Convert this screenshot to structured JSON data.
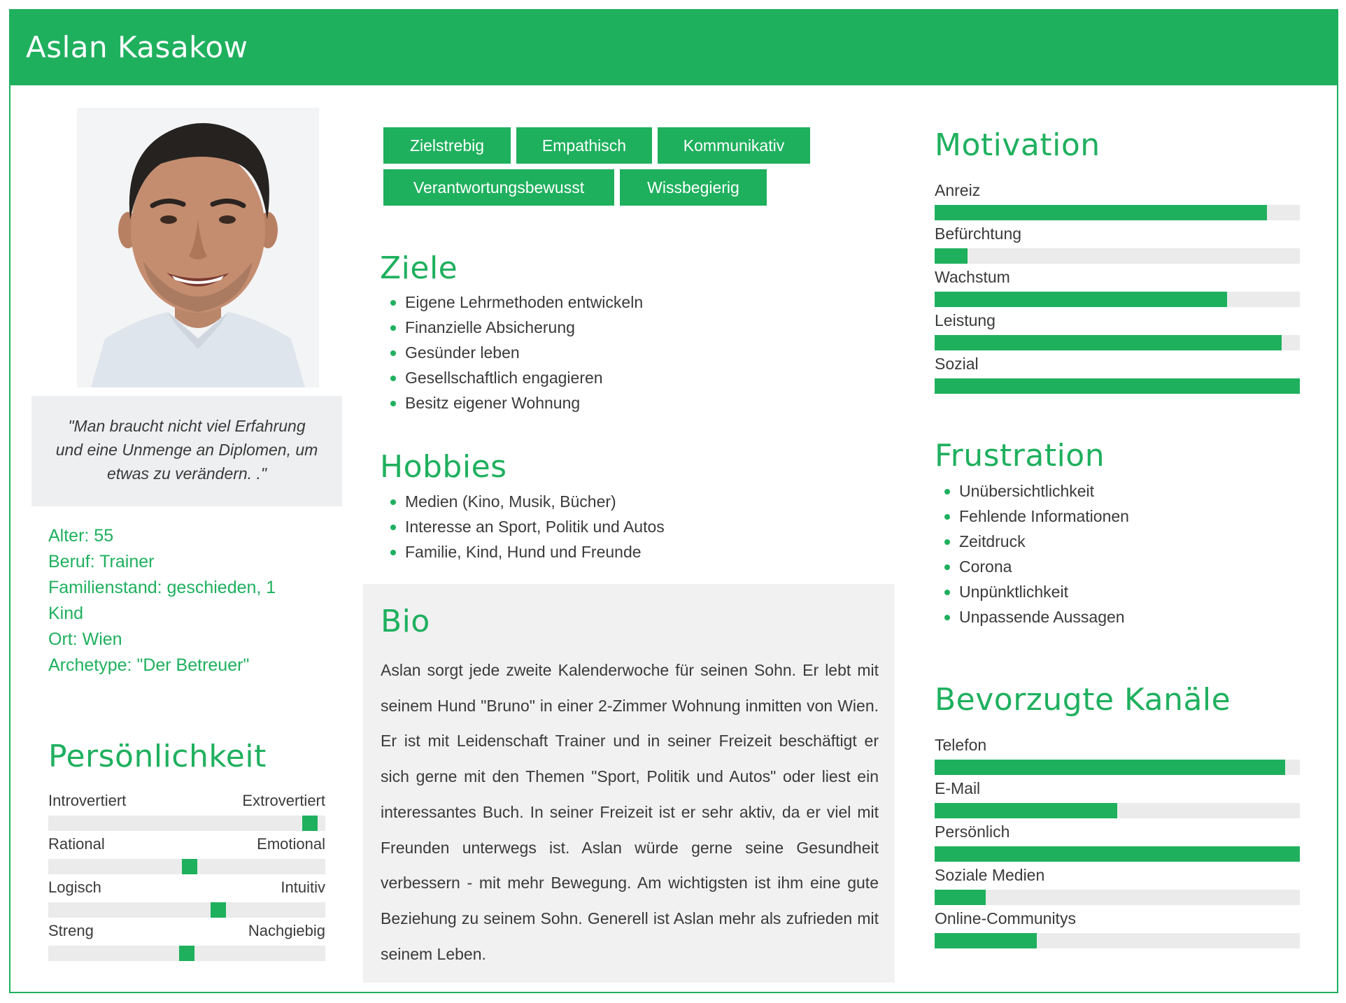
{
  "header": {
    "name": "Aslan Kasakow"
  },
  "quote": "\"Man braucht nicht viel Erfahrung und eine Unmenge an Diplomen, um etwas zu verändern. .\"",
  "facts": [
    "Alter: 55",
    "Beruf: Trainer",
    "Familienstand: geschieden, 1 Kind",
    "Ort: Wien",
    "Archetype: \"Der Betreuer\""
  ],
  "personality": {
    "title": "Persönlichkeit",
    "scales": [
      {
        "left": "Introvertiert",
        "right": "Extrovertiert",
        "value": 0.97
      },
      {
        "left": "Rational",
        "right": "Emotional",
        "value": 0.51
      },
      {
        "left": "Logisch",
        "right": "Intuitiv",
        "value": 0.62
      },
      {
        "left": "Streng",
        "right": "Nachgiebig",
        "value": 0.5
      }
    ]
  },
  "tags": [
    "Zielstrebig",
    "Empathisch",
    "Kommunikativ",
    "Verantwortungsbewusst",
    "Wissbegierig"
  ],
  "goals": {
    "title": "Ziele",
    "items": [
      "Eigene Lehrmethoden entwickeln",
      "Finanzielle Absicherung",
      "Gesünder leben",
      "Gesellschaftlich engagieren",
      "Besitz eigener Wohnung"
    ]
  },
  "hobbies": {
    "title": "Hobbies",
    "items": [
      "Medien (Kino, Musik, Bücher)",
      "Interesse an Sport, Politik und Autos",
      "Familie, Kind, Hund und Freunde"
    ]
  },
  "bio": {
    "title": "Bio",
    "text": "Aslan sorgt jede zweite Kalenderwoche für seinen Sohn. Er lebt mit seinem Hund \"Bruno\" in einer 2-Zimmer Wohnung inmitten von Wien. Er ist mit Leidenschaft Trainer und in seiner Freizeit beschäftigt er sich gerne mit den Themen \"Sport, Politik und Autos\" oder liest ein interessantes Buch. In seiner Freizeit ist er sehr aktiv, da er viel mit Freunden unterwegs ist. Aslan würde gerne seine Gesundheit verbessern - mit mehr Bewegung. Am wichtigsten ist ihm eine gute Beziehung zu seinem Sohn. Generell ist Aslan mehr als zufrieden mit seinem Leben."
  },
  "motivation": {
    "title": "Motivation",
    "items": [
      {
        "label": "Anreiz",
        "value": 0.91
      },
      {
        "label": "Befürchtung",
        "value": 0.09
      },
      {
        "label": "Wachstum",
        "value": 0.8
      },
      {
        "label": "Leistung",
        "value": 0.95
      },
      {
        "label": "Sozial",
        "value": 1.0
      }
    ]
  },
  "frustration": {
    "title": "Frustration",
    "items": [
      "Unübersichtlichkeit",
      "Fehlende Informationen",
      "Zeitdruck",
      "Corona",
      "Unpünktlichkeit",
      "Unpassende Aussagen"
    ]
  },
  "channels": {
    "title": "Bevorzugte Kanäle",
    "items": [
      {
        "label": "Telefon",
        "value": 0.96
      },
      {
        "label": "E-Mail",
        "value": 0.5
      },
      {
        "label": "Persönlich",
        "value": 1.0
      },
      {
        "label": "Soziale Medien",
        "value": 0.14
      },
      {
        "label": "Online-Communitys",
        "value": 0.28
      }
    ]
  },
  "colors": {
    "accent": "#1fb05e",
    "panel": "#f1f1f2",
    "track": "#ebebeb"
  }
}
